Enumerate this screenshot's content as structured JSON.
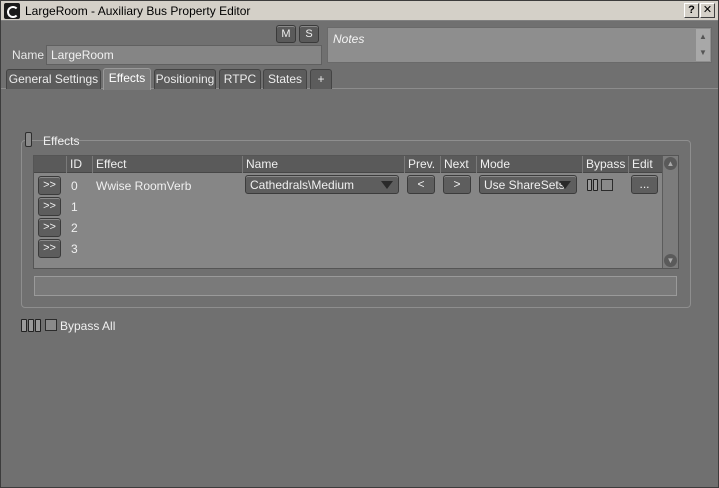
{
  "window": {
    "title": "LargeRoom - Auxiliary Bus Property Editor",
    "help_label": "?",
    "close_label": "✕"
  },
  "header": {
    "mute_label": "M",
    "solo_label": "S",
    "name_label": "Name",
    "name_value": "LargeRoom",
    "notes_placeholder": "Notes",
    "notes_up": "▲",
    "notes_down": "▼"
  },
  "tabs": [
    {
      "label": "General Settings",
      "active": false
    },
    {
      "label": "Effects",
      "active": true
    },
    {
      "label": "Positioning",
      "active": false
    },
    {
      "label": "RTPC",
      "active": false
    },
    {
      "label": "States",
      "active": false
    },
    {
      "label": "+",
      "active": false
    }
  ],
  "effects": {
    "group_label": "Effects",
    "columns": [
      "ID",
      "Effect",
      "Name",
      "Prev.",
      "Next",
      "Mode",
      "Bypass",
      "Edit"
    ],
    "rows": [
      {
        "button": ">>",
        "id": "0",
        "effect": "Wwise RoomVerb",
        "name": "Cathedrals\\Medium",
        "prev": "<",
        "next": ">",
        "mode": "Use ShareSets",
        "edit": "..."
      },
      {
        "button": ">>",
        "id": "1"
      },
      {
        "button": ">>",
        "id": "2"
      },
      {
        "button": ">>",
        "id": "3"
      }
    ],
    "bypass_all_label": "Bypass All"
  }
}
